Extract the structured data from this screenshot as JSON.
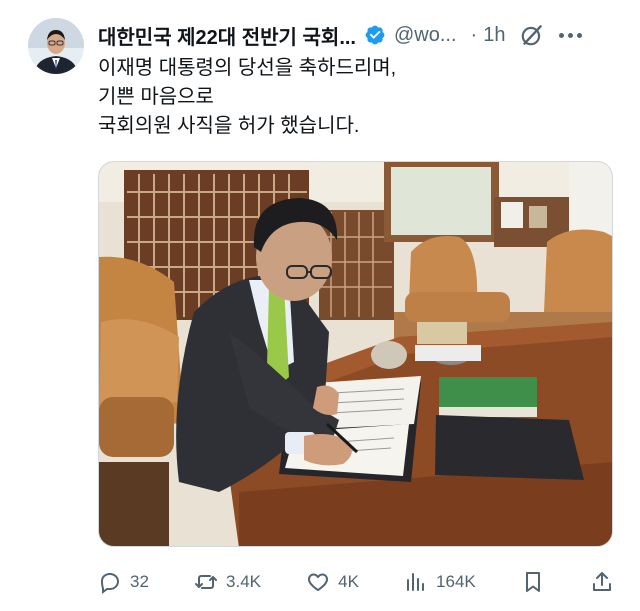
{
  "post": {
    "author_name": "대한민국 제22대 전반기 국회...",
    "handle": "@wo...",
    "separator": "·",
    "time": "1h",
    "text_lines": [
      "이재명 대통령의 당선을 축하드리며,",
      "기쁜 마음으로",
      "국회의원 사직을 허가 했습니다."
    ]
  },
  "actions": {
    "replies": "32",
    "reposts": "3.4K",
    "likes": "4K",
    "views": "164K"
  },
  "colors": {
    "verified": "#1d9bf0",
    "secondary_text": "#536471",
    "primary_text": "#0f1419"
  }
}
